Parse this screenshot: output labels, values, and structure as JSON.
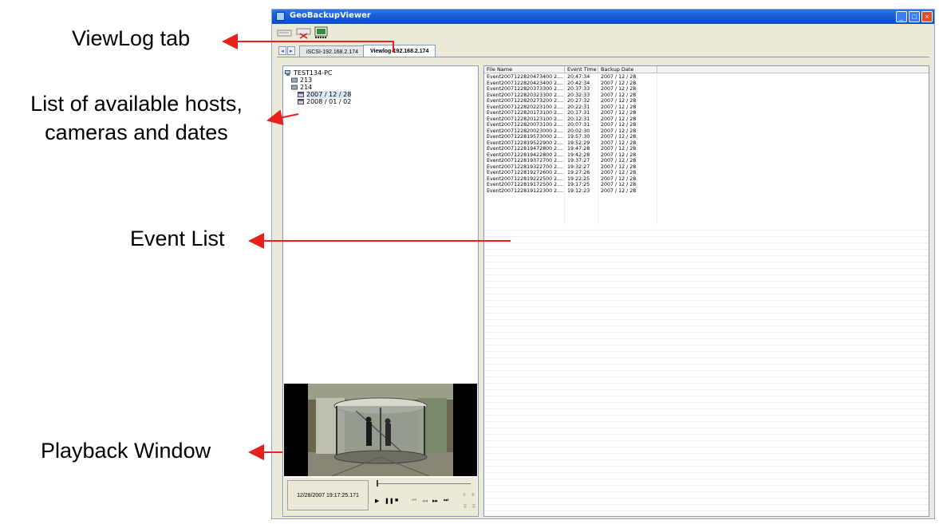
{
  "callouts": {
    "viewlog_tab": "ViewLog tab",
    "hosts_line1": "List of available hosts,",
    "hosts_line2": "cameras and dates",
    "event_list": "Event List",
    "playback": "Playback Window"
  },
  "window": {
    "title": "GeoBackupViewer"
  },
  "tabs": [
    {
      "label": "iSCSI-192.168.2.174",
      "active": false
    },
    {
      "label": "Viewlog-192.168.2.174",
      "active": true
    }
  ],
  "tree": {
    "root": "TEST134-PC",
    "cameras": [
      "213",
      "214"
    ],
    "dates": [
      "2007 / 12 / 28",
      "2008 / 01 / 02"
    ]
  },
  "playback": {
    "timestamp": "12/28/2007 19:17:25.171"
  },
  "event_table": {
    "columns": [
      "File Name",
      "Event Time",
      "Backup Date"
    ],
    "rows": [
      [
        "Event2007122820473400 2....",
        "20:47:34",
        "2007 / 12 / 28"
      ],
      [
        "Event2007122820423400 2....",
        "20:42:34",
        "2007 / 12 / 28"
      ],
      [
        "Event2007122820373300 2....",
        "20:37:33",
        "2007 / 12 / 28"
      ],
      [
        "Event2007122820323300 2....",
        "20:32:33",
        "2007 / 12 / 28"
      ],
      [
        "Event2007122820273200 2....",
        "20:27:32",
        "2007 / 12 / 28"
      ],
      [
        "Event2007122820223100 2....",
        "20:22:31",
        "2007 / 12 / 28"
      ],
      [
        "Event2007122820173100 2....",
        "20:17:31",
        "2007 / 12 / 28"
      ],
      [
        "Event2007122820123100 2....",
        "20:12:31",
        "2007 / 12 / 28"
      ],
      [
        "Event2007122820073100 2....",
        "20:07:31",
        "2007 / 12 / 28"
      ],
      [
        "Event2007122820023000 2....",
        "20:02:30",
        "2007 / 12 / 28"
      ],
      [
        "Event2007122819573000 2....",
        "19:57:30",
        "2007 / 12 / 28"
      ],
      [
        "Event2007122819522900 2....",
        "19:52:29",
        "2007 / 12 / 28"
      ],
      [
        "Event2007122819472800 2....",
        "19:47:28",
        "2007 / 12 / 28"
      ],
      [
        "Event2007122819422800 2....",
        "19:42:28",
        "2007 / 12 / 28"
      ],
      [
        "Event2007122819372700 2....",
        "19:37:27",
        "2007 / 12 / 28"
      ],
      [
        "Event2007122819322700 2....",
        "19:32:27",
        "2007 / 12 / 28"
      ],
      [
        "Event2007122819272600 2....",
        "19:27:26",
        "2007 / 12 / 28"
      ],
      [
        "Event2007122819222500 2....",
        "19:22:25",
        "2007 / 12 / 28"
      ],
      [
        "Event2007122819172500 2....",
        "19:17:25",
        "2007 / 12 / 28"
      ],
      [
        "Event2007122819122300 2....",
        "19:12:23",
        "2007 / 12 / 28"
      ]
    ]
  },
  "colors": {
    "callout_arrow": "#e8201c",
    "titlebar": "#1a5fd6",
    "selection": "#dce6f4"
  }
}
